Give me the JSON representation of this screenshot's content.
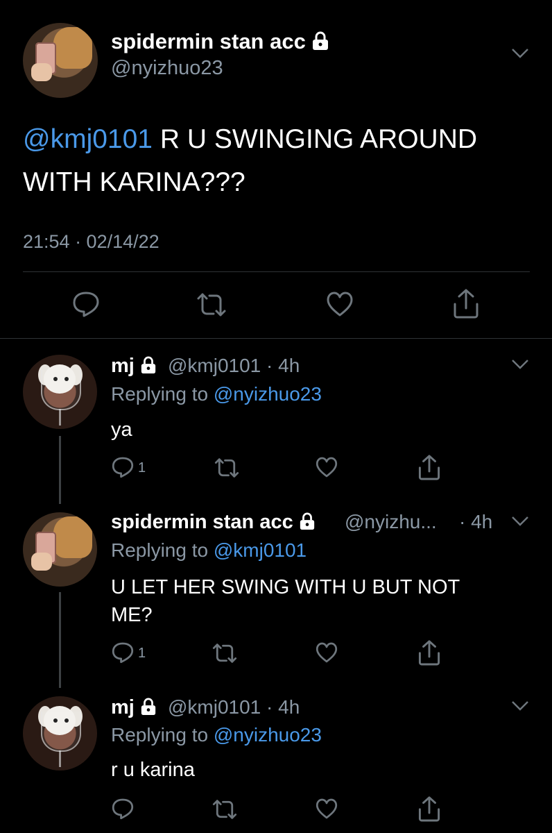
{
  "main_tweet": {
    "display_name": "spidermin stan acc",
    "handle": "@nyizhuo23",
    "mention": "@kmj0101",
    "body_line1_rest": " R U SWINGING AROUND",
    "body_line2": "WITH KARINA???",
    "timestamp": "21:54 · 02/14/22"
  },
  "replies": [
    {
      "display_name": "mj",
      "handle_time": "@kmj0101 · 4h",
      "replying_prefix": "Replying to ",
      "replying_to": "@nyizhuo23",
      "body": "ya",
      "reply_count": "1"
    },
    {
      "display_name": "spidermin stan acc",
      "handle": "@nyizhu...",
      "time": "· 4h",
      "replying_prefix": "Replying to ",
      "replying_to": "@kmj0101",
      "body_line1": "U LET HER SWING WITH U BUT NOT",
      "body_line2": "ME?",
      "reply_count": "1"
    },
    {
      "display_name": "mj",
      "handle_time": "@kmj0101 · 4h",
      "replying_prefix": "Replying to ",
      "replying_to": "@nyizhuo23",
      "body": "r u karina"
    }
  ],
  "colors": {
    "background": "#000000",
    "text": "#ffffff",
    "secondary": "#8b98a5",
    "link": "#4a99e9",
    "icon": "#6e767d",
    "divider": "#2f3336"
  },
  "icons": [
    "lock-icon",
    "chevron-down-icon",
    "reply-icon",
    "retweet-icon",
    "like-icon",
    "share-icon"
  ]
}
